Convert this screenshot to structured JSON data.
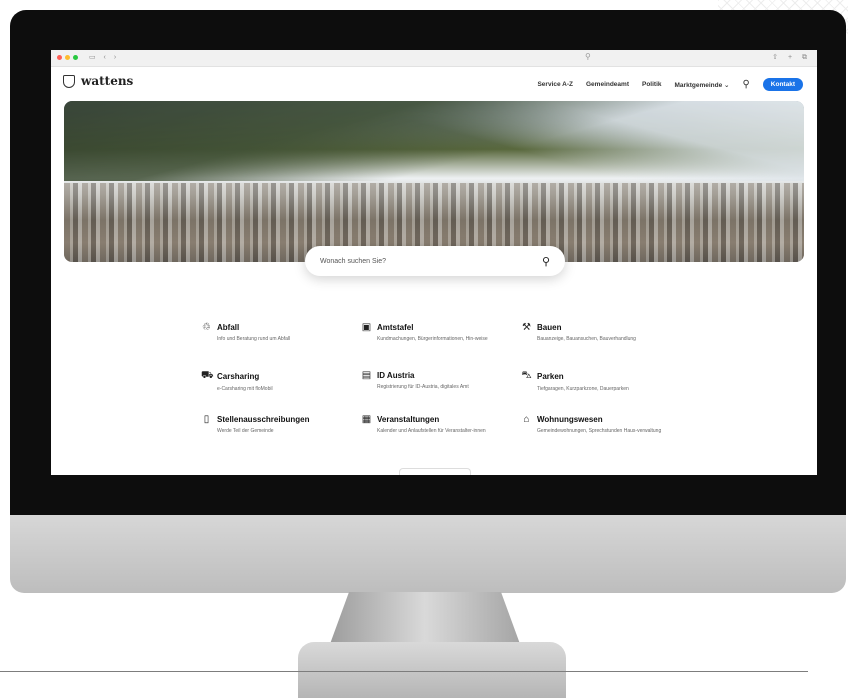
{
  "header": {
    "site_name": "wattens",
    "nav": [
      "Service A-Z",
      "Gemeindeamt",
      "Politik",
      "Marktgemeinde"
    ],
    "dropdown_marker": "⌄",
    "contact_label": "Kontakt"
  },
  "search": {
    "placeholder": "Wonach suchen Sie?"
  },
  "services": [
    {
      "title": "Abfall",
      "desc": "Info und Beratung rund um Abfall",
      "icon": "recycle-icon"
    },
    {
      "title": "Amtstafel",
      "desc": "Kundmachungen, Bürgerinformationen, Hin-weise",
      "icon": "notice-board-icon"
    },
    {
      "title": "Bauen",
      "desc": "Bauanzeige, Bauansuchen, Bauverhandlung",
      "icon": "trowel-icon"
    },
    {
      "title": "Carsharing",
      "desc": "e-Carsharing mit floMobil",
      "icon": "car-icon"
    },
    {
      "title": "ID Austria",
      "desc": "Registrierung für ID-Austria, digitales Amt",
      "icon": "id-card-icon"
    },
    {
      "title": "Parken",
      "desc": "Tiefgaragen, Kurzparkzone, Dauerparken",
      "icon": "parking-car-icon"
    },
    {
      "title": "Stellenausschreibungen",
      "desc": "Werde Teil der Gemeinde",
      "icon": "document-icon"
    },
    {
      "title": "Veranstaltungen",
      "desc": "Kalender und Anlaufstellen für Veranstalter-innen",
      "icon": "calendar-icon"
    },
    {
      "title": "Wohnungswesen",
      "desc": "Gemeindewohnungen, Sprechstunden Haus-verwaltung",
      "icon": "building-icon"
    }
  ],
  "colors": {
    "accent": "#1a73e8",
    "bezel": "#0d0d0d",
    "chin": "#cfcfcf"
  }
}
